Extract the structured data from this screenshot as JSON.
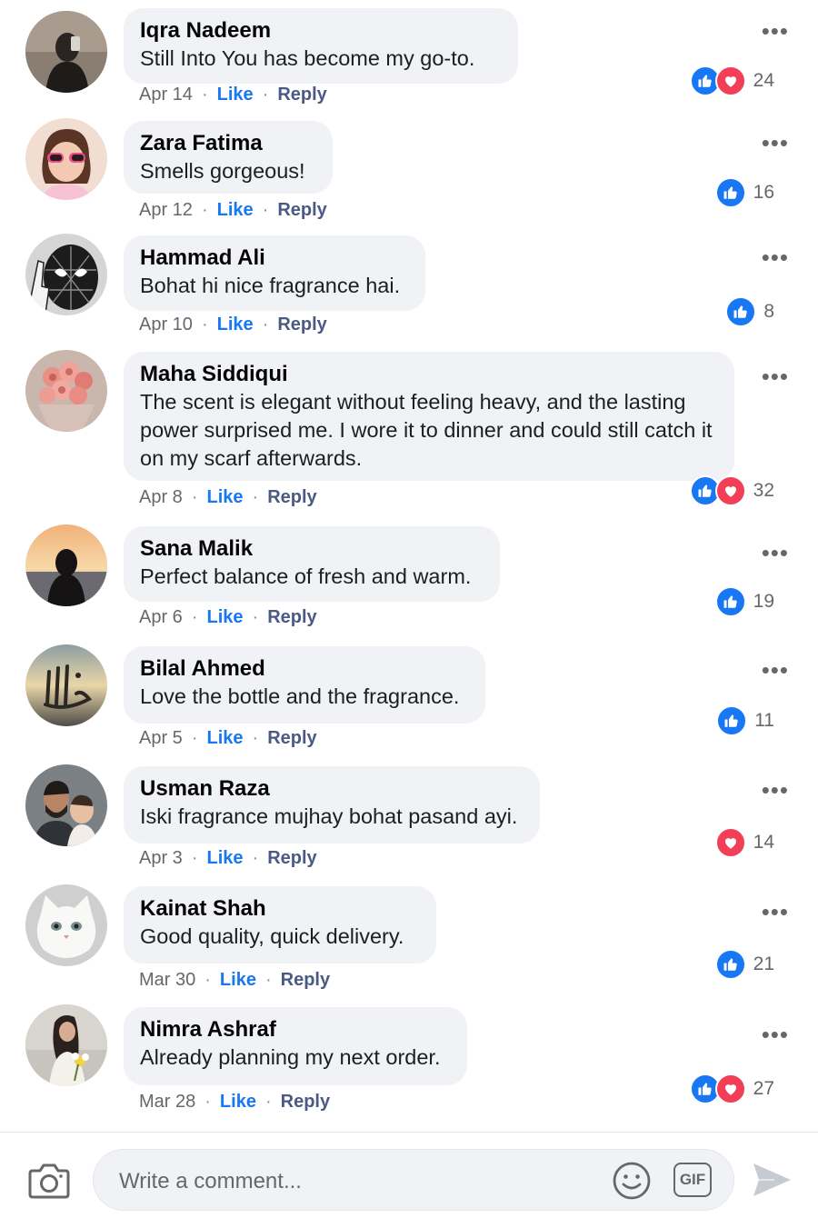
{
  "comments": [
    {
      "author": "Iqra Nadeem",
      "text": "Still Into You has become my go-to.",
      "date": "Apr 14",
      "like_label": "Like",
      "reply_label": "Reply",
      "reactions": [
        "like",
        "love"
      ],
      "count": "24"
    },
    {
      "author": "Zara Fatima",
      "text": "Smells gorgeous!",
      "date": "Apr 12",
      "like_label": "Like",
      "reply_label": "Reply",
      "reactions": [
        "like"
      ],
      "count": "16"
    },
    {
      "author": "Hammad Ali",
      "text": "Bohat hi nice fragrance hai.",
      "date": "Apr 10",
      "like_label": "Like",
      "reply_label": "Reply",
      "reactions": [
        "like"
      ],
      "count": "8"
    },
    {
      "author": "Maha Siddiqui",
      "text": "The scent is elegant without feeling heavy, and the lasting power surprised me. I wore it to dinner and could still catch it on my scarf afterwards.",
      "date": "Apr 8",
      "like_label": "Like",
      "reply_label": "Reply",
      "reactions": [
        "like",
        "love"
      ],
      "count": "32"
    },
    {
      "author": "Sana Malik",
      "text": "Perfect balance of fresh and warm.",
      "date": "Apr 6",
      "like_label": "Like",
      "reply_label": "Reply",
      "reactions": [
        "like"
      ],
      "count": "19"
    },
    {
      "author": "Bilal Ahmed",
      "text": "Love the bottle and the fragrance.",
      "date": "Apr 5",
      "like_label": "Like",
      "reply_label": "Reply",
      "reactions": [
        "like"
      ],
      "count": "11"
    },
    {
      "author": "Usman Raza",
      "text": "Iski fragrance mujhay bohat pasand ayi.",
      "date": "Apr 3",
      "like_label": "Like",
      "reply_label": "Reply",
      "reactions": [
        "love"
      ],
      "count": "14"
    },
    {
      "author": "Kainat Shah",
      "text": "Good quality, quick delivery.",
      "date": "Mar 30",
      "like_label": "Like",
      "reply_label": "Reply",
      "reactions": [
        "like"
      ],
      "count": "21"
    },
    {
      "author": "Nimra Ashraf",
      "text": "Already planning my next order.",
      "date": "Mar 28",
      "like_label": "Like",
      "reply_label": "Reply",
      "reactions": [
        "like",
        "love"
      ],
      "count": "27"
    }
  ],
  "more_label": "•••",
  "composer": {
    "placeholder": "Write a comment...",
    "gif_label": "GIF",
    "icons": {
      "camera": "camera-icon",
      "emoji": "emoji-icon",
      "send": "send-icon"
    }
  },
  "colors": {
    "like": "#1877f2",
    "love": "#f33e58",
    "bubble": "#f0f2f5",
    "reply": "#4b5a84"
  }
}
